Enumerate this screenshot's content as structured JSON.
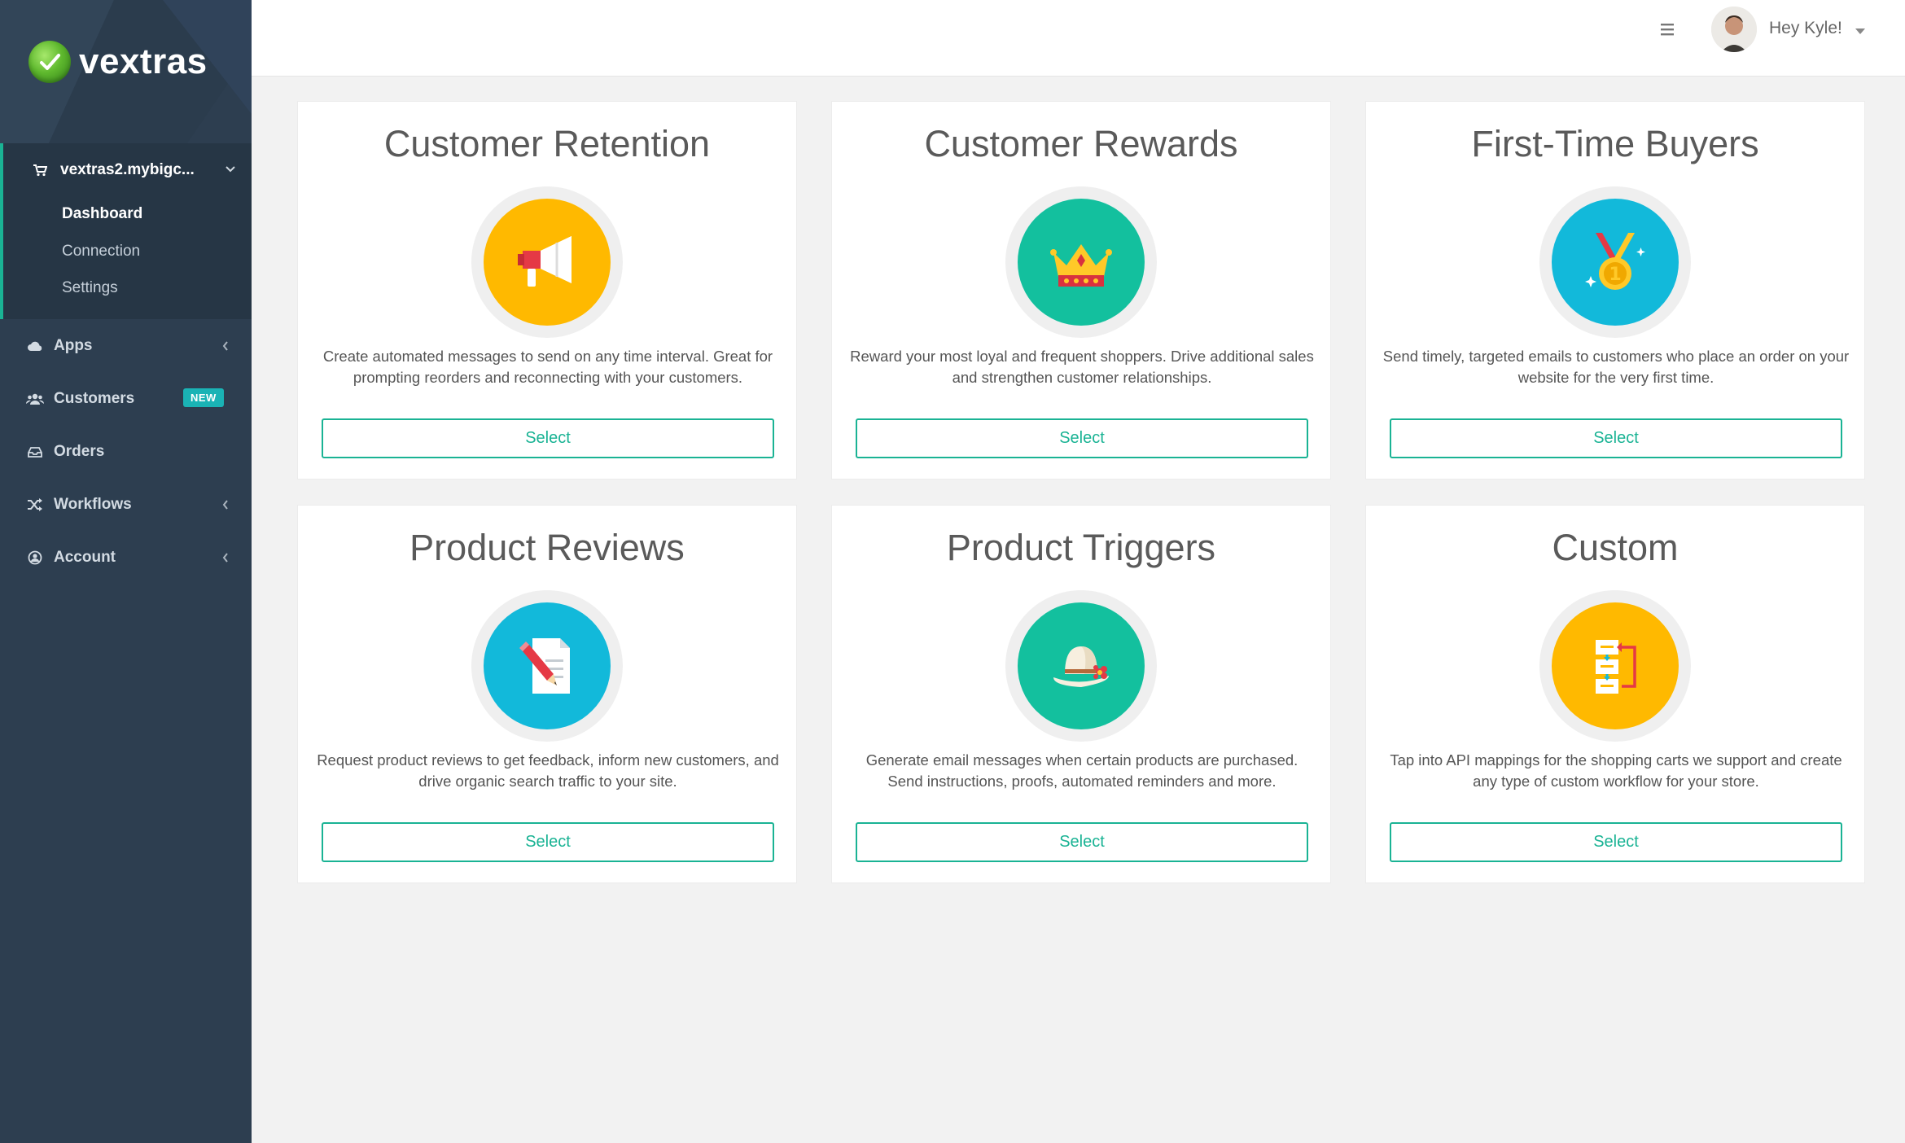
{
  "brand": {
    "name": "vextras"
  },
  "sidebar": {
    "store": {
      "label": "vextras2.mybigc...",
      "items": [
        {
          "label": "Dashboard",
          "active": true
        },
        {
          "label": "Connection",
          "active": false
        },
        {
          "label": "Settings",
          "active": false
        }
      ]
    },
    "nav": [
      {
        "label": "Apps",
        "icon": "cloud-icon",
        "has_chevron": true
      },
      {
        "label": "Customers",
        "icon": "users-icon",
        "badge": "NEW"
      },
      {
        "label": "Orders",
        "icon": "inbox-icon"
      },
      {
        "label": "Workflows",
        "icon": "shuffle-icon",
        "has_chevron": true
      },
      {
        "label": "Account",
        "icon": "user-circle-icon",
        "has_chevron": true
      }
    ]
  },
  "header": {
    "greeting": "Hey Kyle!"
  },
  "cards": [
    {
      "title": "Customer Retention",
      "icon": "megaphone-icon",
      "color": "#ffb900",
      "description": "Create automated messages to send on any time interval. Great for prompting reorders and reconnecting with your customers.",
      "button": "Select"
    },
    {
      "title": "Customer Rewards",
      "icon": "crown-icon",
      "color": "#13c09e",
      "description": "Reward your most loyal and frequent shoppers. Drive additional sales and strengthen customer relationships.",
      "button": "Select"
    },
    {
      "title": "First-Time Buyers",
      "icon": "medal-icon",
      "color": "#12b9da",
      "description": "Send timely, targeted emails to customers who place an order on your website for the very first time.",
      "button": "Select"
    },
    {
      "title": "Product Reviews",
      "icon": "document-pencil-icon",
      "color": "#12b9da",
      "description": "Request product reviews to get feedback, inform new customers, and drive organic search traffic to your site.",
      "button": "Select"
    },
    {
      "title": "Product Triggers",
      "icon": "sun-hat-icon",
      "color": "#13c09e",
      "description": "Generate email messages when certain products are purchased. Send instructions, proofs, automated reminders and more.",
      "button": "Select"
    },
    {
      "title": "Custom",
      "icon": "workflow-icon",
      "color": "#ffb900",
      "description": "Tap into API mappings for the shopping carts we support and create any type of custom workflow for your store.",
      "button": "Select"
    }
  ],
  "colors": {
    "sidebar": "#2d3e50",
    "accent": "#1ab394",
    "badge": "#1ab3b5"
  }
}
